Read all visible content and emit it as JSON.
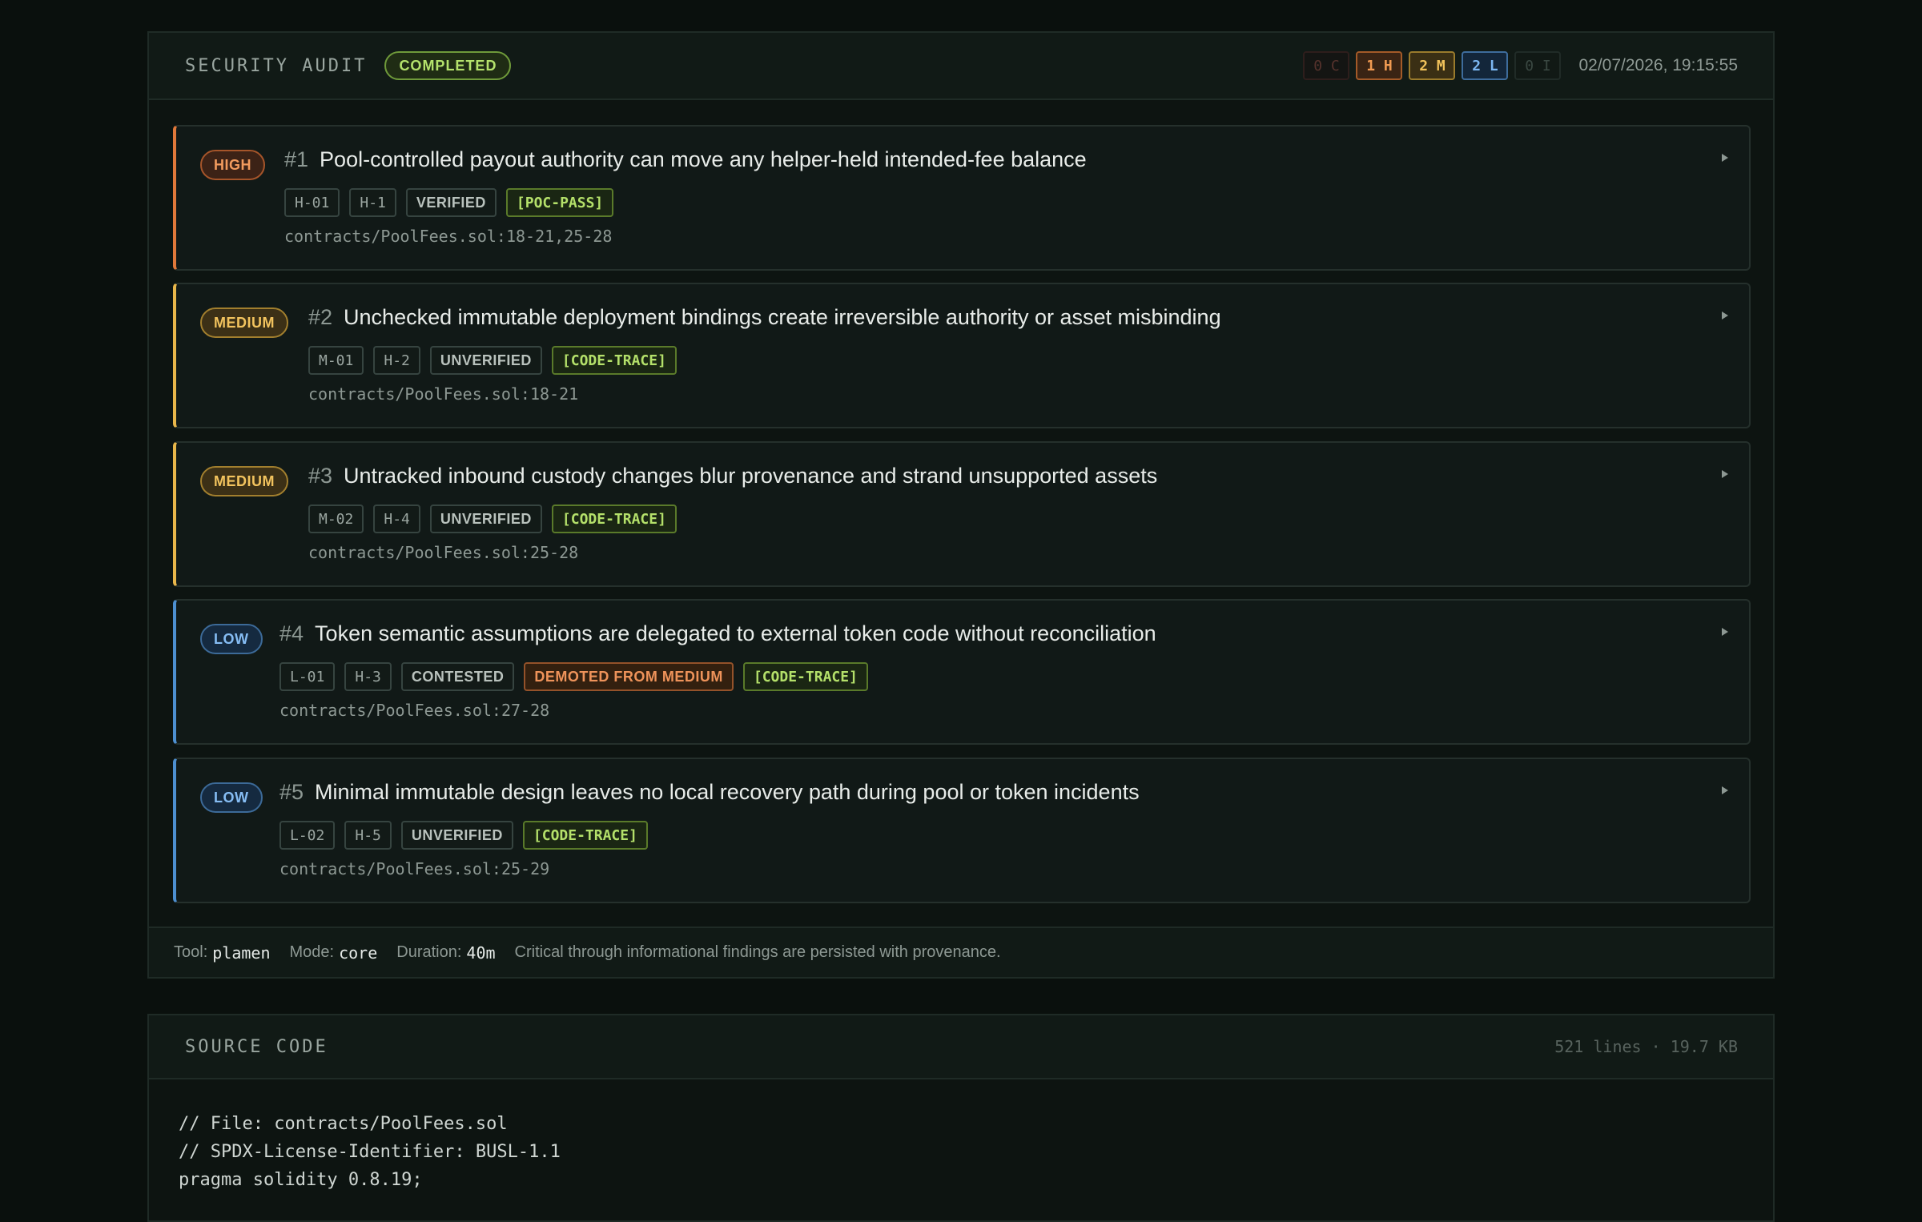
{
  "audit": {
    "title": "SECURITY AUDIT",
    "status": "COMPLETED",
    "counts": [
      {
        "label": "0 C",
        "severity": "critical"
      },
      {
        "label": "1 H",
        "severity": "high"
      },
      {
        "label": "2 M",
        "severity": "medium"
      },
      {
        "label": "2 L",
        "severity": "low"
      },
      {
        "label": "0 I",
        "severity": "informational"
      }
    ],
    "timestamp": "02/07/2026, 19:15:55",
    "findings": [
      {
        "severity": "HIGH",
        "number": "#1",
        "title": "Pool-controlled payout authority can move any helper-held intended-fee balance",
        "tags": [
          "H-01",
          "H-1",
          "VERIFIED",
          "[POC-PASS]"
        ],
        "location": "contracts/PoolFees.sol:18-21,25-28"
      },
      {
        "severity": "MEDIUM",
        "number": "#2",
        "title": "Unchecked immutable deployment bindings create irreversible authority or asset misbinding",
        "tags": [
          "M-01",
          "H-2",
          "UNVERIFIED",
          "[CODE-TRACE]"
        ],
        "location": "contracts/PoolFees.sol:18-21"
      },
      {
        "severity": "MEDIUM",
        "number": "#3",
        "title": "Untracked inbound custody changes blur provenance and strand unsupported assets",
        "tags": [
          "M-02",
          "H-4",
          "UNVERIFIED",
          "[CODE-TRACE]"
        ],
        "location": "contracts/PoolFees.sol:25-28"
      },
      {
        "severity": "LOW",
        "number": "#4",
        "title": "Token semantic assumptions are delegated to external token code without reconciliation",
        "tags": [
          "L-01",
          "H-3",
          "CONTESTED",
          "DEMOTED FROM MEDIUM",
          "[CODE-TRACE]"
        ],
        "location": "contracts/PoolFees.sol:27-28"
      },
      {
        "severity": "LOW",
        "number": "#5",
        "title": "Minimal immutable design leaves no local recovery path during pool or token incidents",
        "tags": [
          "L-02",
          "H-5",
          "UNVERIFIED",
          "[CODE-TRACE]"
        ],
        "location": "contracts/PoolFees.sol:25-29"
      }
    ],
    "footer": {
      "tool_label": "Tool:",
      "tool": "plamen",
      "mode_label": "Mode:",
      "mode": "core",
      "duration_label": "Duration:",
      "duration": "40m",
      "note": "Critical through informational findings are persisted with provenance."
    }
  },
  "source": {
    "title": "SOURCE CODE",
    "meta": "521 lines · 19.7 KB",
    "lines": [
      "// File: contracts/PoolFees.sol",
      "// SPDX-License-Identifier: BUSL-1.1",
      "pragma solidity 0.8.19;"
    ]
  },
  "colors": {
    "background": "#0a100d",
    "high": "#e0783a",
    "medium": "#e8b64a",
    "low": "#4d8fd0",
    "status_green": "#b4e26c"
  },
  "icons": {
    "expand": "expand-arrow-icon"
  }
}
